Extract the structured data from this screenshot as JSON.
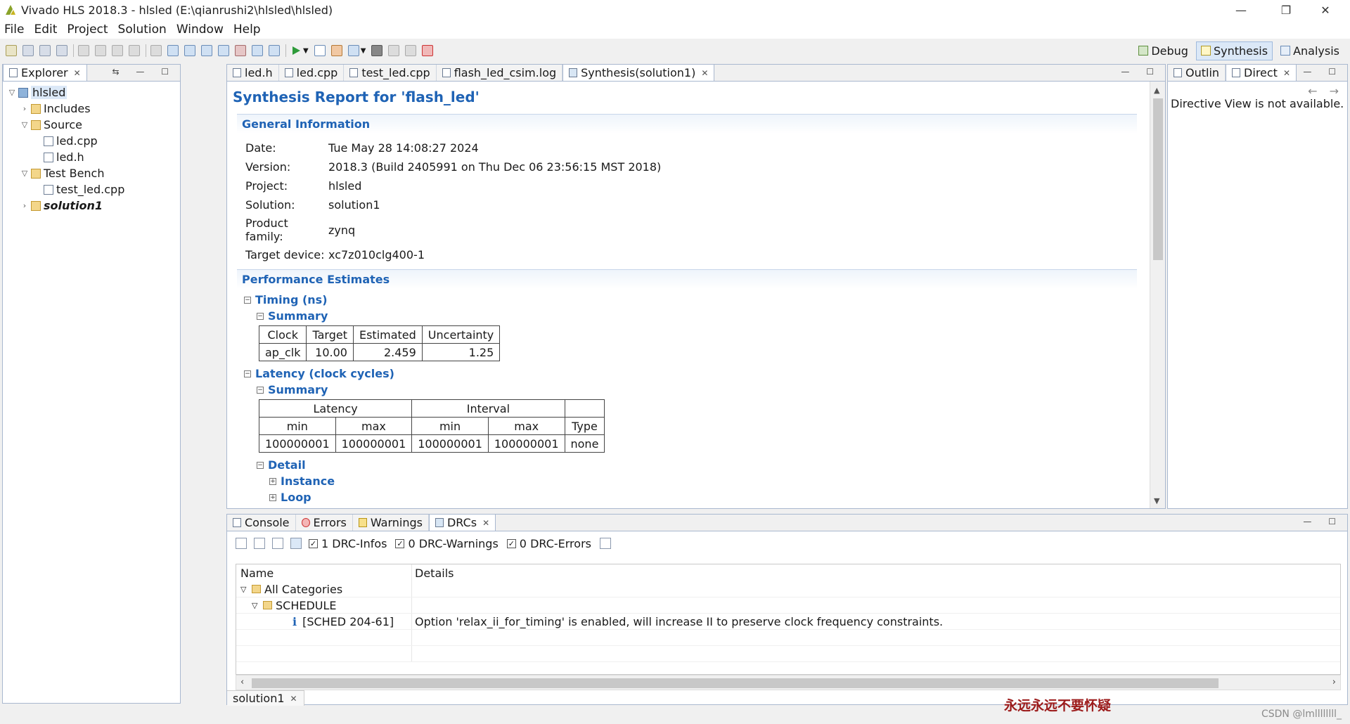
{
  "window": {
    "title": "Vivado HLS 2018.3 - hlsled (E:\\qianrushi2\\hlsled\\hlsled)",
    "controls": [
      "—",
      "❐",
      "✕"
    ]
  },
  "menu": [
    "File",
    "Edit",
    "Project",
    "Solution",
    "Window",
    "Help"
  ],
  "perspectives": [
    {
      "label": "Debug",
      "active": false
    },
    {
      "label": "Synthesis",
      "active": true
    },
    {
      "label": "Analysis",
      "active": false
    }
  ],
  "explorer": {
    "tab_label": "Explorer",
    "tree": [
      {
        "label": "hlsled",
        "level": 0,
        "arrow": "v",
        "icon": "project",
        "selected": true
      },
      {
        "label": "Includes",
        "level": 1,
        "arrow": ">",
        "icon": "folder"
      },
      {
        "label": "Source",
        "level": 1,
        "arrow": "v",
        "icon": "folder"
      },
      {
        "label": "led.cpp",
        "level": 2,
        "arrow": "",
        "icon": "file"
      },
      {
        "label": "led.h",
        "level": 2,
        "arrow": "",
        "icon": "file"
      },
      {
        "label": "Test Bench",
        "level": 1,
        "arrow": "v",
        "icon": "folder"
      },
      {
        "label": "test_led.cpp",
        "level": 2,
        "arrow": "",
        "icon": "file"
      },
      {
        "label": "solution1",
        "level": 1,
        "arrow": ">",
        "icon": "folder",
        "bold_italic": true
      }
    ]
  },
  "editor": {
    "tabs": [
      {
        "label": "led.h",
        "active": false
      },
      {
        "label": "led.cpp",
        "active": false
      },
      {
        "label": "test_led.cpp",
        "active": false
      },
      {
        "label": "flash_led_csim.log",
        "active": false
      },
      {
        "label": "Synthesis(solution1)",
        "active": true,
        "closable": true
      }
    ],
    "report": {
      "title": "Synthesis Report for 'flash_led'",
      "general_heading": "General Information",
      "general": [
        {
          "k": "Date:",
          "v": "Tue May 28 14:08:27 2024"
        },
        {
          "k": "Version:",
          "v": "2018.3 (Build 2405991 on Thu Dec 06 23:56:15 MST 2018)"
        },
        {
          "k": "Project:",
          "v": "hlsled"
        },
        {
          "k": "Solution:",
          "v": "solution1"
        },
        {
          "k": "Product family:",
          "v": "zynq"
        },
        {
          "k": "Target device:",
          "v": "xc7z010clg400-1"
        }
      ],
      "perf_heading": "Performance Estimates",
      "timing_heading": "Timing (ns)",
      "summary_label": "Summary",
      "timing_table": {
        "headers": [
          "Clock",
          "Target",
          "Estimated",
          "Uncertainty"
        ],
        "rows": [
          [
            "ap_clk",
            "10.00",
            "2.459",
            "1.25"
          ]
        ]
      },
      "latency_heading": "Latency (clock cycles)",
      "latency_table": {
        "group_headers": [
          "Latency",
          "Interval"
        ],
        "sub_headers": [
          "min",
          "max",
          "min",
          "max",
          "Type"
        ],
        "rows": [
          [
            "100000001",
            "100000001",
            "100000001",
            "100000001",
            "none"
          ]
        ]
      },
      "detail_heading": "Detail",
      "instance_label": "Instance",
      "loop_label": "Loop"
    }
  },
  "directive": {
    "tabs": [
      {
        "label": "Outlin",
        "active": false
      },
      {
        "label": "Direct",
        "active": true,
        "closable": true
      }
    ],
    "message": "Directive View is not available."
  },
  "bottom": {
    "tabs": [
      {
        "label": "Console",
        "active": false
      },
      {
        "label": "Errors",
        "active": false
      },
      {
        "label": "Warnings",
        "active": false
      },
      {
        "label": "DRCs",
        "active": true,
        "closable": true
      }
    ],
    "filters": [
      {
        "label": "1 DRC-Infos",
        "checked": true
      },
      {
        "label": "0 DRC-Warnings",
        "checked": true
      },
      {
        "label": "0 DRC-Errors",
        "checked": true
      }
    ],
    "columns": [
      "Name",
      "Details"
    ],
    "rows": [
      {
        "name": "All Categories",
        "details": "",
        "level": 0,
        "arrow": "v",
        "kind": "folder"
      },
      {
        "name": "SCHEDULE",
        "details": "",
        "level": 1,
        "arrow": "v",
        "kind": "folder"
      },
      {
        "name": "[SCHED 204-61]",
        "details": "Option 'relax_ii_for_timing' is enabled, will increase II to preserve clock frequency constraints.",
        "level": 2,
        "arrow": "",
        "kind": "info"
      }
    ],
    "bottom_tab": "solution1"
  },
  "watermark": "永远永远不要怀疑",
  "csdn_credit": "CSDN @lmllllllll_",
  "colors": {
    "accent": "#1f63b5",
    "panel_border": "#a9b8cf",
    "active_tab": "#dbe8f7"
  }
}
